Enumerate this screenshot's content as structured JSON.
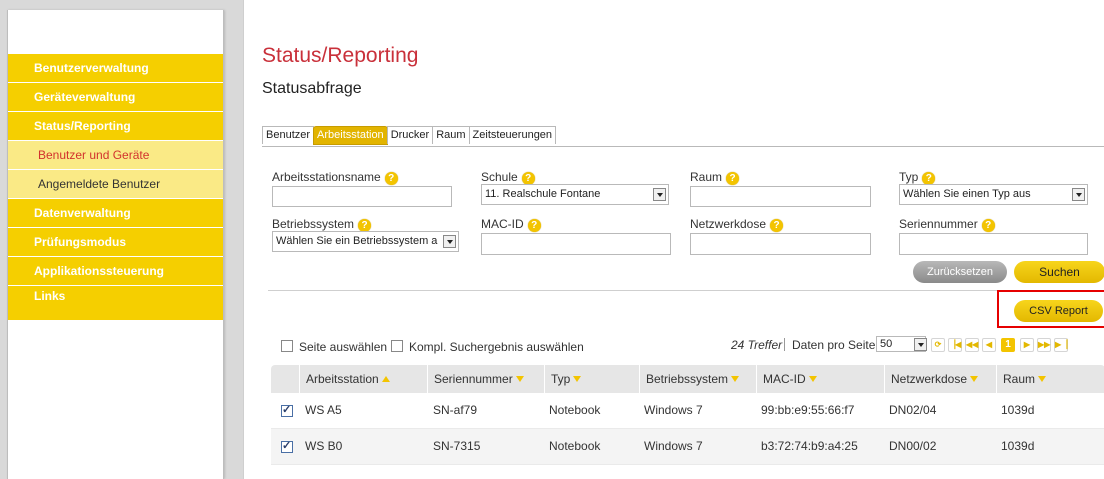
{
  "sidebar": {
    "items": [
      {
        "label": "Benutzerverwaltung",
        "kind": "main"
      },
      {
        "label": "Geräteverwaltung",
        "kind": "main"
      },
      {
        "label": "Status/Reporting",
        "kind": "main"
      },
      {
        "label": "Benutzer und Geräte",
        "kind": "sub",
        "active": true
      },
      {
        "label": "Angemeldete Benutzer",
        "kind": "sub"
      },
      {
        "label": "Datenverwaltung",
        "kind": "main"
      },
      {
        "label": "Prüfungsmodus",
        "kind": "main"
      },
      {
        "label": "Applikationssteuerung",
        "kind": "main"
      },
      {
        "label": "Links",
        "kind": "main"
      }
    ]
  },
  "page": {
    "title": "Status/Reporting",
    "subtitle": "Statusabfrage"
  },
  "tabs": [
    "Benutzer",
    "Arbeitsstation",
    "Drucker",
    "Raum",
    "Zeitsteuerungen"
  ],
  "active_tab": "Arbeitsstation",
  "filters": {
    "arbeitsstationsname": {
      "label": "Arbeitsstationsname",
      "value": ""
    },
    "schule": {
      "label": "Schule",
      "value": "11. Realschule Fontane"
    },
    "raum": {
      "label": "Raum",
      "value": ""
    },
    "typ": {
      "label": "Typ",
      "value": "Wählen Sie einen Typ aus"
    },
    "betriebssystem": {
      "label": "Betriebssystem",
      "value": "Wählen Sie ein Betriebssystem a"
    },
    "macid": {
      "label": "MAC-ID",
      "value": ""
    },
    "netzwerkdose": {
      "label": "Netzwerkdose",
      "value": ""
    },
    "seriennummer": {
      "label": "Seriennummer",
      "value": ""
    },
    "help_glyph": "?"
  },
  "buttons": {
    "reset": "Zurücksetzen",
    "search": "Suchen",
    "csv": "CSV Report"
  },
  "selection": {
    "page_select": "Seite auswählen",
    "all_select": "Kompl. Suchergebnis auswählen"
  },
  "pager": {
    "hits": "24 Treffer",
    "per_page_label": "Daten pro Seite:",
    "per_page": "50",
    "current_page": "1",
    "icons": [
      "refresh-icon",
      "first-page-icon",
      "prev-block-icon",
      "prev-page-icon",
      "next-page-icon",
      "next-block-icon",
      "last-page-icon"
    ]
  },
  "table": {
    "columns": [
      "Arbeitsstation",
      "Seriennummer",
      "Typ",
      "Betriebssystem",
      "MAC-ID",
      "Netzwerkdose",
      "Raum"
    ],
    "rows": [
      {
        "checked": true,
        "cells": [
          "WS A5",
          "SN-af79",
          "Notebook",
          "Windows 7",
          "99:bb:e9:55:66:f7",
          "DN02/04",
          "1039d"
        ]
      },
      {
        "checked": true,
        "cells": [
          "WS B0",
          "SN-7315",
          "Notebook",
          "Windows 7",
          "b3:72:74:b9:a4:25",
          "DN00/02",
          "1039d"
        ]
      }
    ]
  },
  "colors": {
    "accent_yellow": "#f5cf00",
    "title_red": "#c9303a",
    "highlight_red": "#e60000"
  }
}
